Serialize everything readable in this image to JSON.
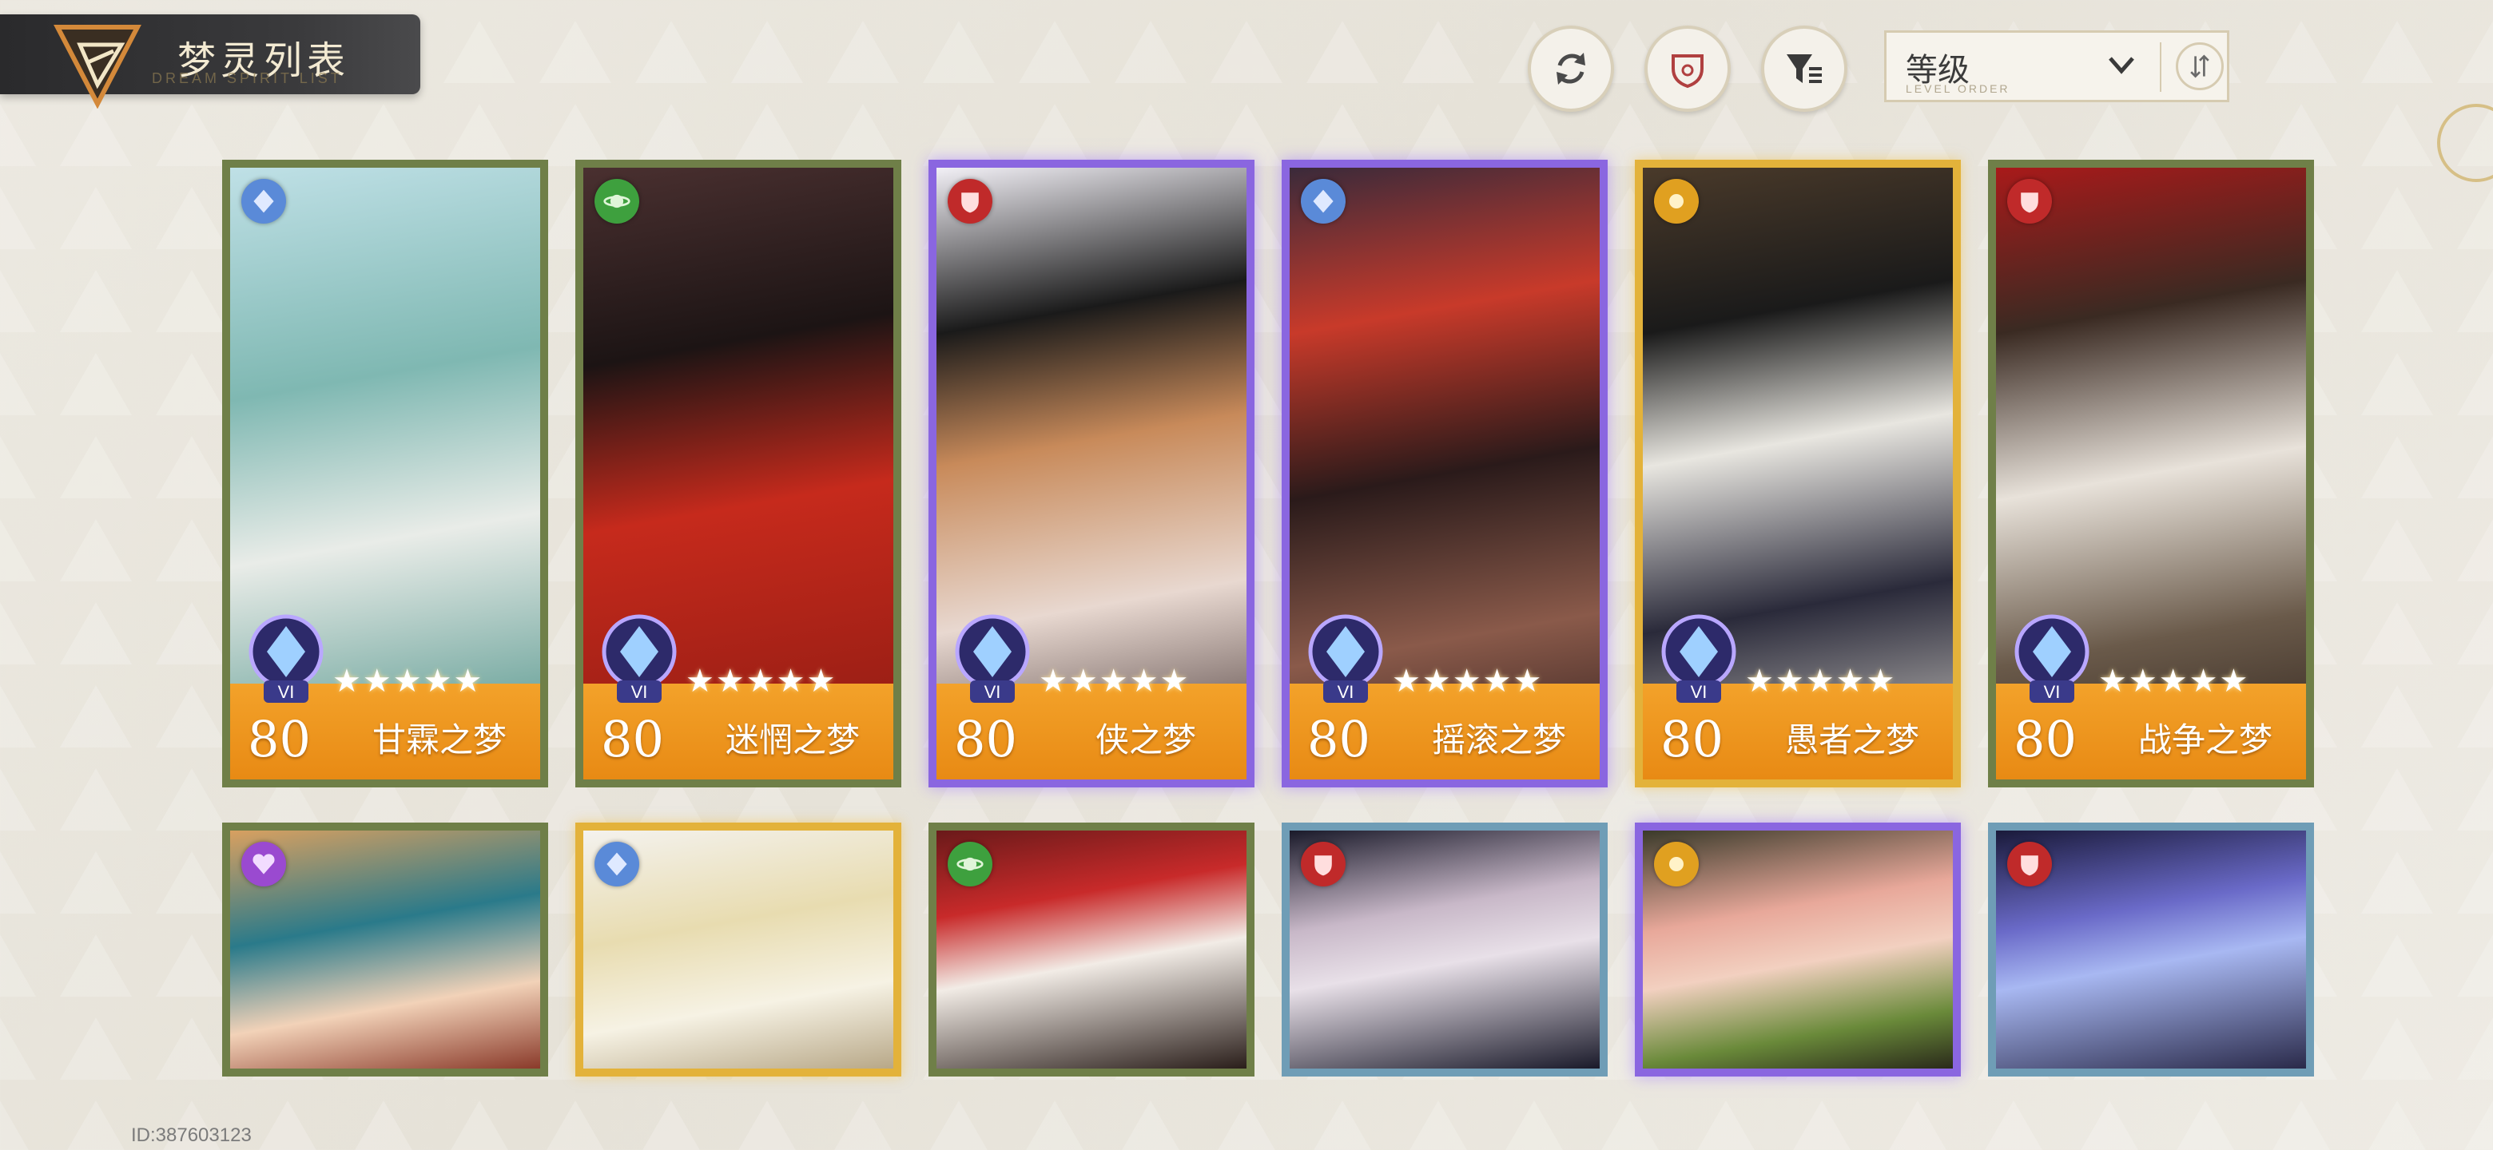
{
  "header": {
    "title": "梦灵列表",
    "subtitle": "DREAM SPIRIT LIST"
  },
  "toolbar": {
    "refresh_icon": "refresh-icon",
    "element_filter_icon": "shield-icon",
    "filter_icon": "filter-icon",
    "sort": {
      "selected": "等级",
      "sub_label": "LEVEL ORDER"
    }
  },
  "cards": [
    {
      "name": "甘霖之梦",
      "level": "80",
      "rank": "VI",
      "stars": "★★★★★",
      "frame": "green",
      "element": "diamond",
      "element_color": "#5a8ad8"
    },
    {
      "name": "迷惘之梦",
      "level": "80",
      "rank": "VI",
      "stars": "★★★★★",
      "frame": "green",
      "element": "planet",
      "element_color": "#3ea03e"
    },
    {
      "name": "侠之梦",
      "level": "80",
      "rank": "VI",
      "stars": "★★★★★",
      "frame": "purple",
      "element": "shield",
      "element_color": "#c02a2a"
    },
    {
      "name": "摇滚之梦",
      "level": "80",
      "rank": "VI",
      "stars": "★★★★★",
      "frame": "purple",
      "element": "diamond",
      "element_color": "#5a8ad8"
    },
    {
      "name": "愚者之梦",
      "level": "80",
      "rank": "VI",
      "stars": "★★★★★",
      "frame": "gold",
      "element": "orb",
      "element_color": "#e0a020"
    },
    {
      "name": "战争之梦",
      "level": "80",
      "rank": "VI",
      "stars": "★★★★★",
      "frame": "green",
      "element": "shield",
      "element_color": "#c02a2a"
    },
    {
      "frame": "green",
      "element": "heart",
      "element_color": "#9a4ad0"
    },
    {
      "frame": "gold",
      "element": "diamond",
      "element_color": "#5a8ad8"
    },
    {
      "frame": "green",
      "element": "planet",
      "element_color": "#3ea03e"
    },
    {
      "frame": "blue",
      "element": "shield",
      "element_color": "#c02a2a"
    },
    {
      "frame": "purple",
      "element": "orb",
      "element_color": "#e0a020"
    },
    {
      "frame": "blue",
      "element": "shield",
      "element_color": "#c02a2a"
    }
  ],
  "footer": {
    "player_id": "ID:387603123"
  }
}
